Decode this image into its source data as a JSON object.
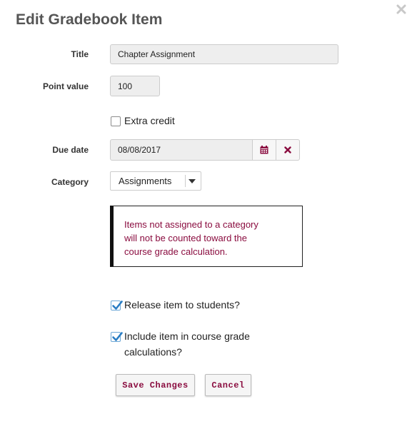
{
  "dialog": {
    "title": "Edit Gradebook Item",
    "close_icon": "close-x-icon"
  },
  "form": {
    "title_label": "Title",
    "title_value": "Chapter Assignment",
    "points_label": "Point value",
    "points_value": "100",
    "extra_credit_label": "Extra credit",
    "extra_credit_checked": false,
    "due_date_label": "Due date",
    "due_date_value": "08/08/2017",
    "calendar_icon": "calendar-icon",
    "clear_icon": "clear-x-icon",
    "category_label": "Category",
    "category_value": "Assignments",
    "category_options": [
      "Assignments"
    ],
    "category_notice_lines": [
      "Items not assigned to a category",
      "will not be counted toward the",
      "course grade calculation."
    ],
    "release_label": "Release item to students?",
    "release_checked": true,
    "include_label_line1": "Include item in course grade",
    "include_label_line2": "calculations?",
    "include_checked": true
  },
  "actions": {
    "save_label": "Save Changes",
    "cancel_label": "Cancel"
  },
  "colors": {
    "accent": "#8a0c3f",
    "title_text": "#555555",
    "check_blue": "#2a7dc4",
    "notice_border": "#111111",
    "field_background": "#eeeeee"
  }
}
